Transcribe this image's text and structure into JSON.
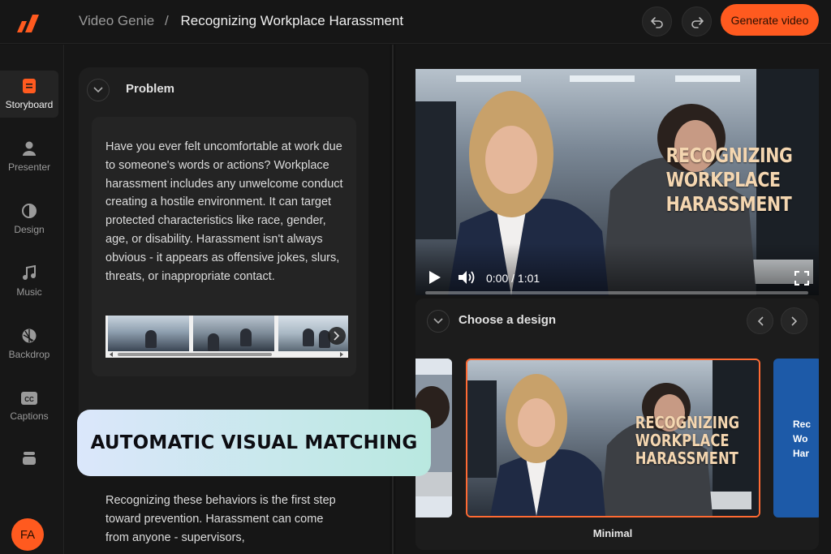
{
  "header": {
    "breadcrumb_root": "Video Genie",
    "breadcrumb_sep": "/",
    "project_title": "Recognizing Workplace Harassment",
    "generate_label": "Generate video"
  },
  "sidebar": {
    "items": [
      {
        "label": "Storyboard",
        "icon": "storyboard-icon",
        "active": true
      },
      {
        "label": "Presenter",
        "icon": "presenter-icon"
      },
      {
        "label": "Design",
        "icon": "design-icon"
      },
      {
        "label": "Music",
        "icon": "music-icon"
      },
      {
        "label": "Backdrop",
        "icon": "backdrop-icon"
      },
      {
        "label": "Captions",
        "icon": "captions-icon"
      },
      {
        "label": "",
        "icon": "layers-icon"
      }
    ],
    "avatar_initials": "FA"
  },
  "scene": {
    "title": "Problem",
    "paragraph": "Have you ever felt uncomfortable at work due to someone's words or actions? Workplace harassment includes any unwelcome conduct creating a hostile environment. It can target protected characteristics like race, gender, age, or disability. Harassment isn't always obvious - it appears as offensive jokes, slurs, threats, or inappropriate contact.",
    "next_paragraph": "Recognizing these behaviors is the first step toward prevention. Harassment can come from anyone - supervisors,"
  },
  "video": {
    "overlay_title": "RECOGNIZING WORKPLACE HARASSMENT",
    "time": "0:00 / 1:01",
    "progress": 0
  },
  "design": {
    "section_title": "Choose a design",
    "selected_label": "Minimal",
    "selected_overlay": "RECOGNIZING WORKPLACE HARASSMENT",
    "right_tile_text": "Rec\nWo\nHar"
  },
  "banner": {
    "text": "AUTOMATIC VISUAL MATCHING"
  },
  "colors": {
    "accent": "#ff5a1f",
    "selected_border": "#ff6a33",
    "banner_start": "#dbe7fb",
    "banner_end": "#b9e8e0"
  }
}
